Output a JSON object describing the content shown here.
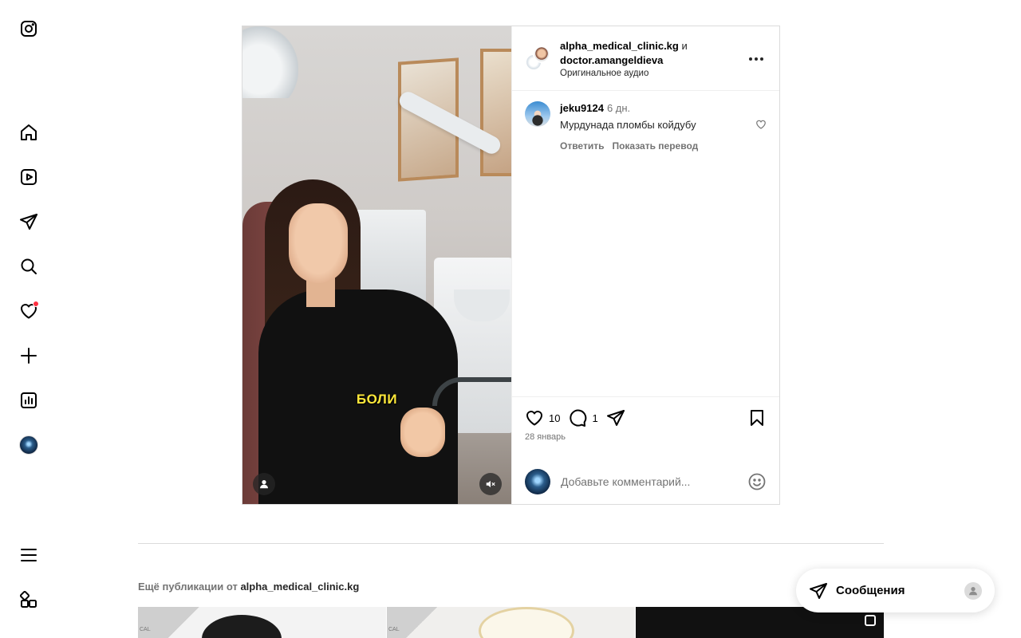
{
  "nav": {
    "logo": "instagram-icon",
    "items": [
      {
        "name": "home-icon"
      },
      {
        "name": "reels-icon"
      },
      {
        "name": "direct-icon"
      },
      {
        "name": "search-icon"
      },
      {
        "name": "notifications-icon",
        "badge": true
      },
      {
        "name": "create-icon"
      },
      {
        "name": "insights-icon"
      },
      {
        "name": "profile-avatar"
      }
    ],
    "bottom": [
      {
        "name": "more-menu-icon"
      },
      {
        "name": "also-from-meta-icon"
      }
    ]
  },
  "post": {
    "author1": "alpha_medical_clinic.kg",
    "joiner": "и",
    "author2": "doctor.amangeldieva",
    "audio": "Оригинальное аудио",
    "video_caption": "БОЛИ",
    "likes": "10",
    "comments_count": "1",
    "date": "28 январь",
    "comment_placeholder": "Добавьте комментарий..."
  },
  "comments": [
    {
      "user": "jeku9124",
      "time": "6 дн.",
      "text": "Мурдунада пломбы койдубу",
      "reply": "Ответить",
      "translate": "Показать перевод"
    }
  ],
  "more_posts": {
    "prefix": "Ещё публикации от",
    "account": "alpha_medical_clinic.kg",
    "thumb_label": "CAL"
  },
  "messages": {
    "label": "Сообщения"
  },
  "colors": {
    "accent_red": "#ff3040",
    "caption_yellow": "#ffe83a",
    "secondary_text": "#737373",
    "border": "#dbdbdb"
  }
}
